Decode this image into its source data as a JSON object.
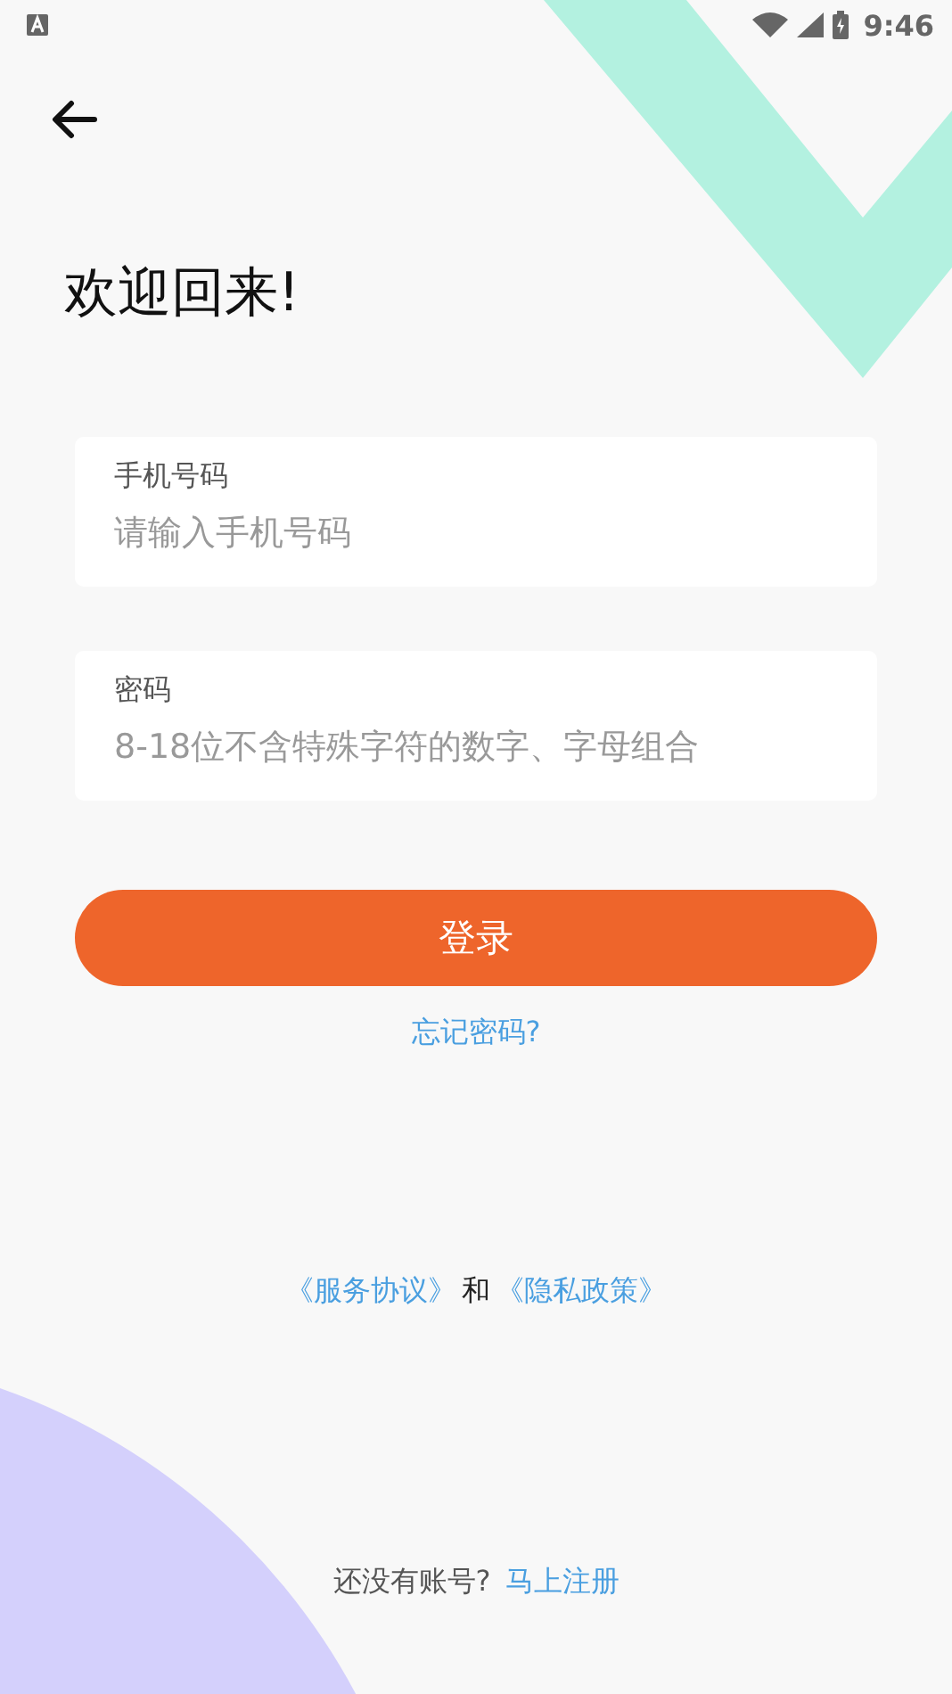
{
  "status_bar": {
    "time": "9:46"
  },
  "title": "欢迎回来!",
  "fields": [
    {
      "label": "手机号码",
      "placeholder": "请输入手机号码"
    },
    {
      "label": "密码",
      "placeholder": "8-18位不含特殊字符的数字、字母组合"
    }
  ],
  "login_button": "登录",
  "forgot_link": "忘记密码?",
  "agreement": {
    "service_link": "《服务协议》",
    "joiner": "和",
    "privacy_link": "《隐私政策》"
  },
  "signup": {
    "prompt": "还没有账号?",
    "link": "马上注册"
  }
}
